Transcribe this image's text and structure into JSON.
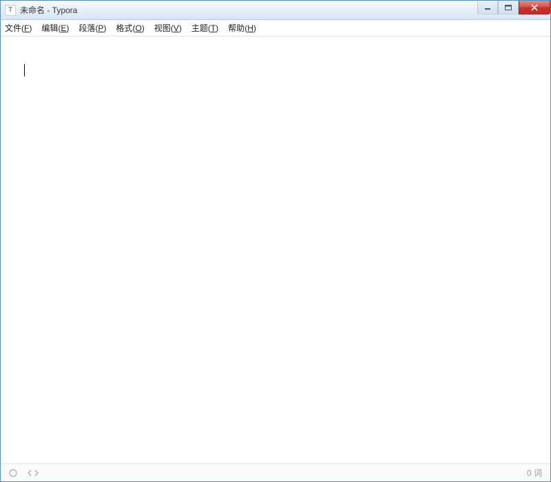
{
  "titlebar": {
    "app_icon_letter": "T",
    "title": "未命名 - Typora"
  },
  "menubar": {
    "items": [
      {
        "label": "文件",
        "accel": "F"
      },
      {
        "label": "编辑",
        "accel": "E"
      },
      {
        "label": "段落",
        "accel": "P"
      },
      {
        "label": "格式",
        "accel": "O"
      },
      {
        "label": "视图",
        "accel": "V"
      },
      {
        "label": "主题",
        "accel": "T"
      },
      {
        "label": "帮助",
        "accel": "H"
      }
    ]
  },
  "editor": {
    "content": ""
  },
  "statusbar": {
    "word_count": "0 词"
  }
}
